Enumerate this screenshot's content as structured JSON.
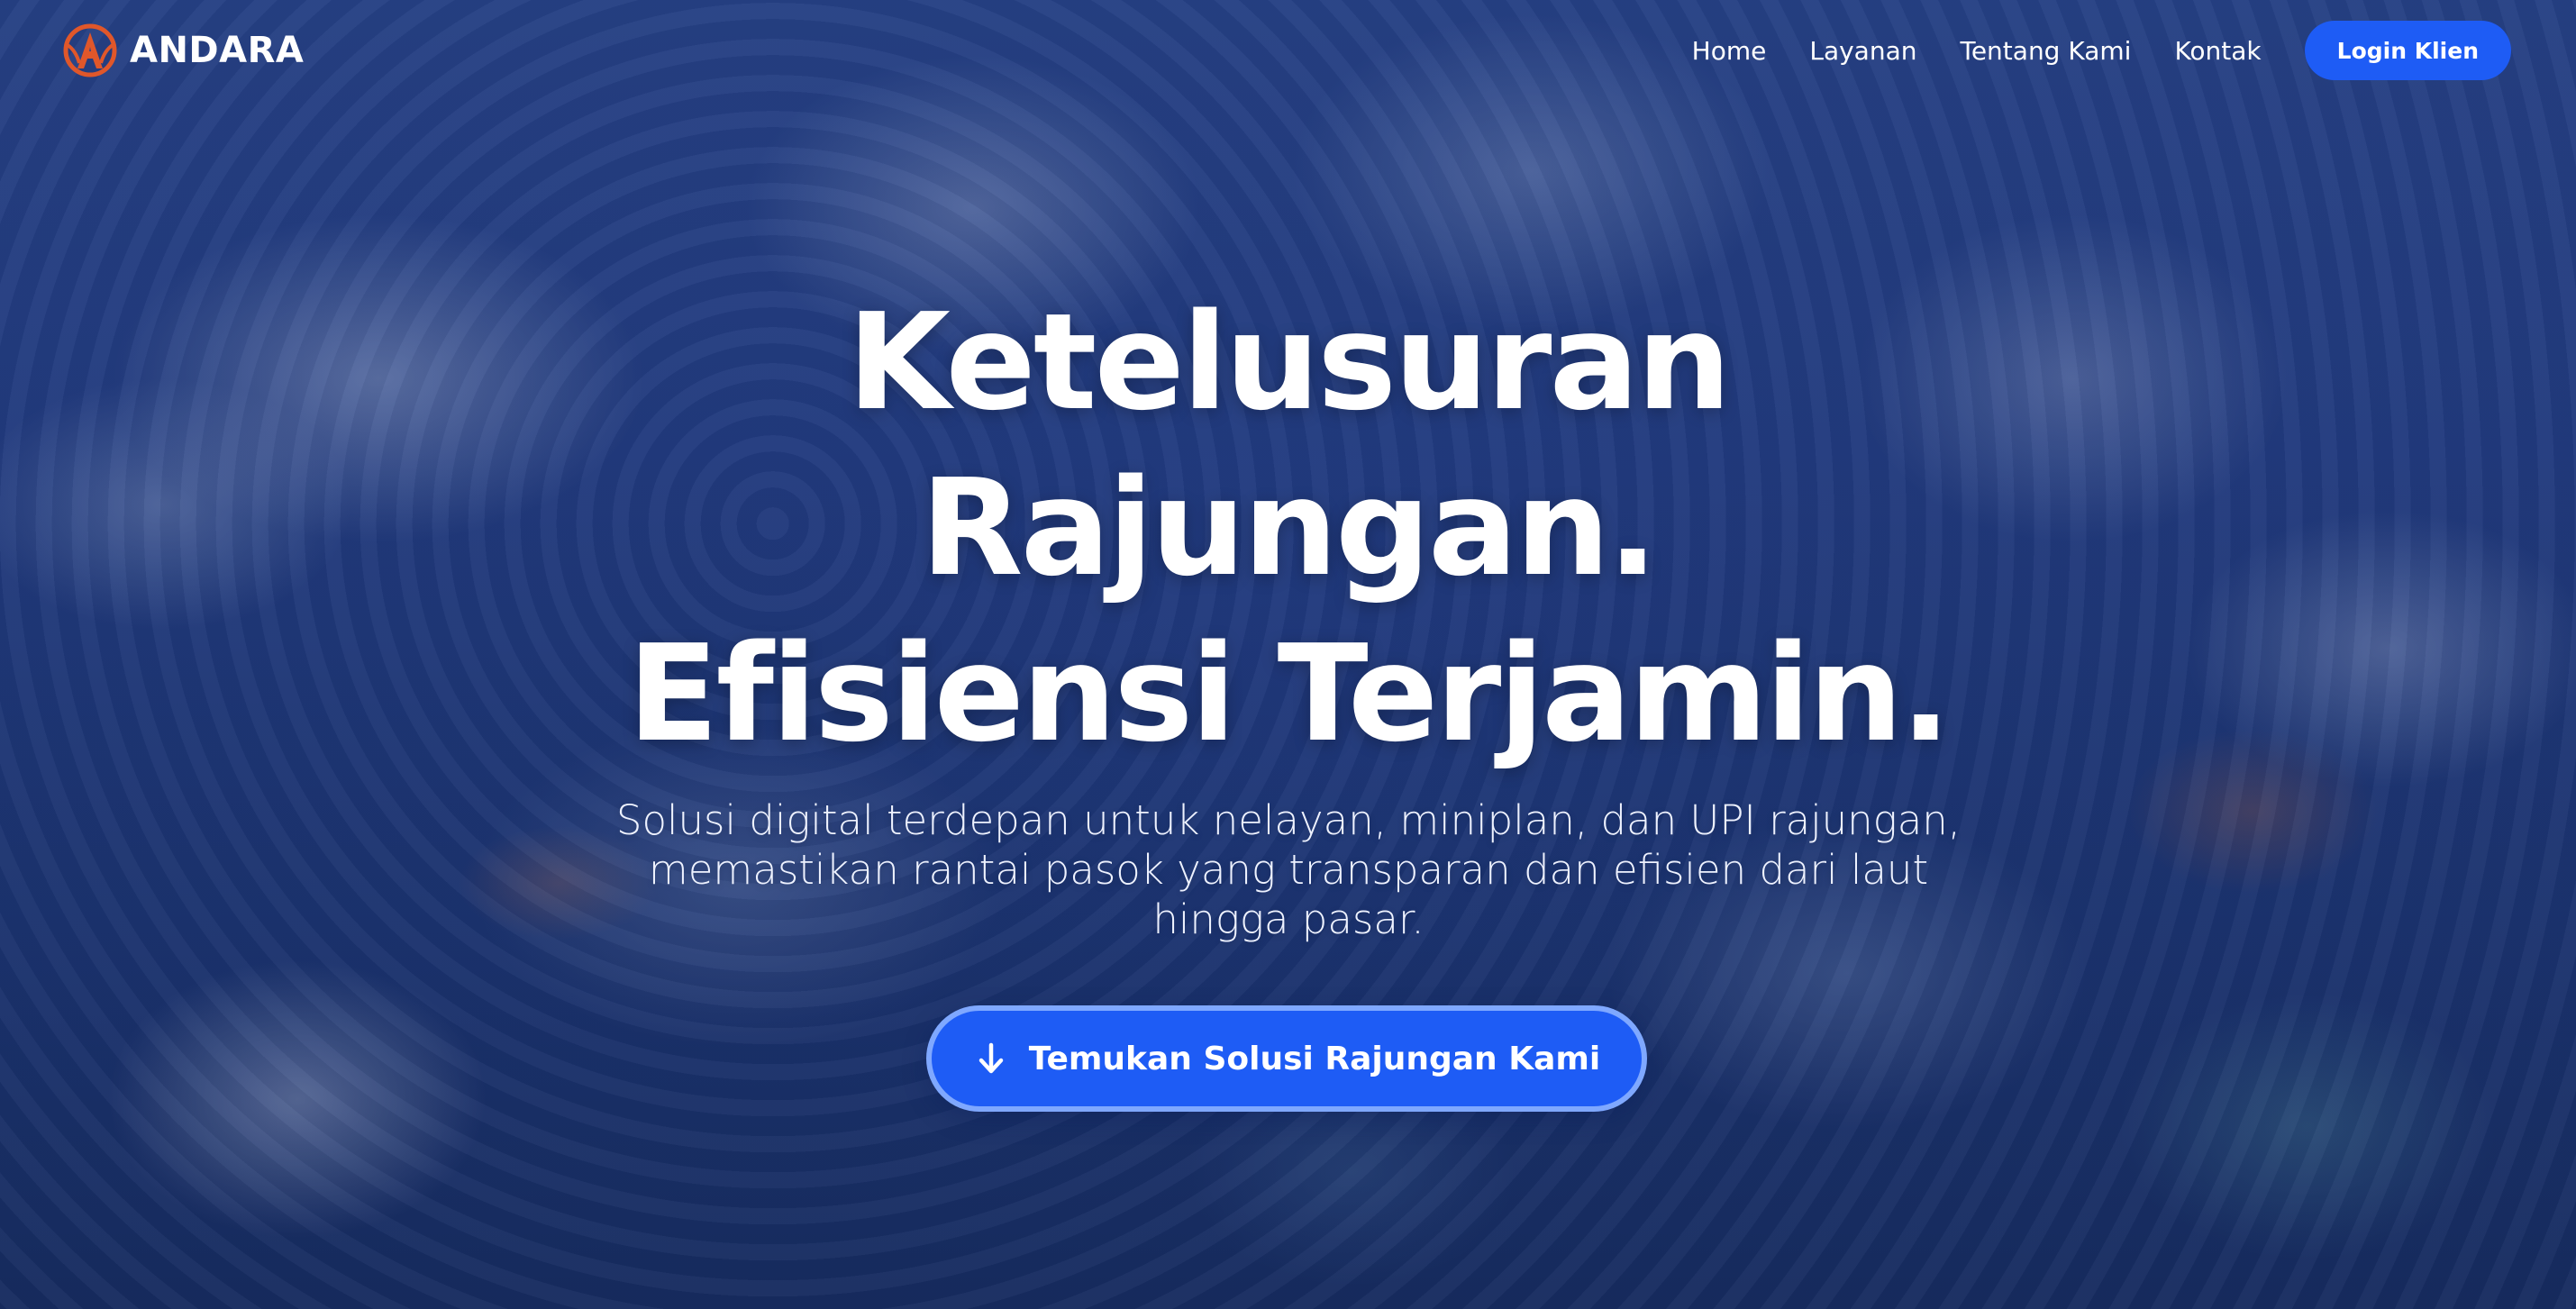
{
  "brand": {
    "name": "ANDARA",
    "logo_icon": "andara-logo-icon",
    "logo_color": "#e0572a"
  },
  "nav": {
    "links": [
      {
        "label": "Home"
      },
      {
        "label": "Layanan"
      },
      {
        "label": "Tentang Kami"
      },
      {
        "label": "Kontak"
      }
    ],
    "login_label": "Login Klien"
  },
  "hero": {
    "headline_lines": [
      "Ketelusuran",
      "Rajungan.",
      "Efisiensi Terjamin."
    ],
    "subtitle": "Solusi digital terdepan untuk nelayan, miniplan, dan UPI rajungan, memastikan rantai pasok yang transparan dan efisien dari laut hingga pasar.",
    "cta_label": "Temukan Solusi Rajungan Kami",
    "cta_icon": "arrow-down-icon",
    "background_image": "blue-crabs-photo"
  },
  "colors": {
    "accent": "#1e5cf5",
    "accent_border": "#7fa8ff",
    "text": "#ffffff"
  }
}
